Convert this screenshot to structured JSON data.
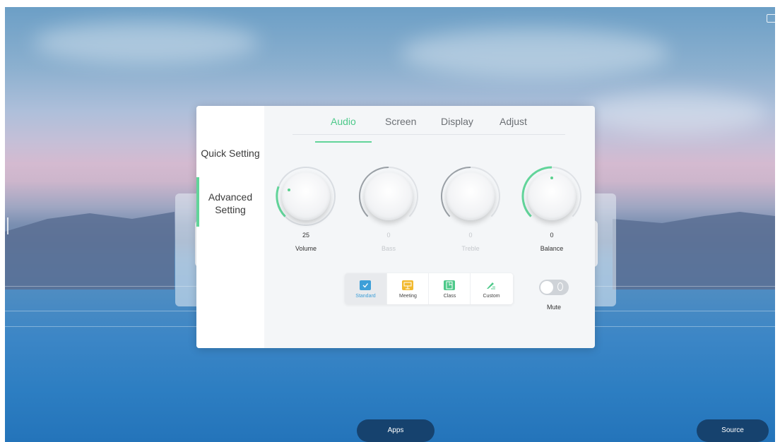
{
  "side_nav": {
    "items": [
      {
        "label": "Quick Setting",
        "active": false
      },
      {
        "label": "Advanced\nSetting",
        "active": true
      }
    ]
  },
  "tabs": [
    {
      "label": "Audio",
      "active": true
    },
    {
      "label": "Screen",
      "active": false
    },
    {
      "label": "Display",
      "active": false
    },
    {
      "label": "Adjust",
      "active": false
    }
  ],
  "knobs": [
    {
      "label": "Volume",
      "value": "25",
      "enabled": true
    },
    {
      "label": "Bass",
      "value": "0",
      "enabled": false
    },
    {
      "label": "Treble",
      "value": "0",
      "enabled": false
    },
    {
      "label": "Balance",
      "value": "0",
      "enabled": true
    }
  ],
  "sound_modes": [
    {
      "label": "Standard",
      "icon": "standard-icon",
      "active": true
    },
    {
      "label": "Meeting",
      "icon": "meeting-icon",
      "active": false
    },
    {
      "label": "Class",
      "icon": "class-icon",
      "active": false
    },
    {
      "label": "Custom",
      "icon": "custom-icon",
      "active": false
    }
  ],
  "mute": {
    "label": "Mute",
    "on": false
  },
  "dock": {
    "apps_label": "Apps",
    "source_label": "Source"
  },
  "colors": {
    "accent": "#62d49a",
    "active_text": "#3d9fd8",
    "dock_button": "#16426e"
  }
}
